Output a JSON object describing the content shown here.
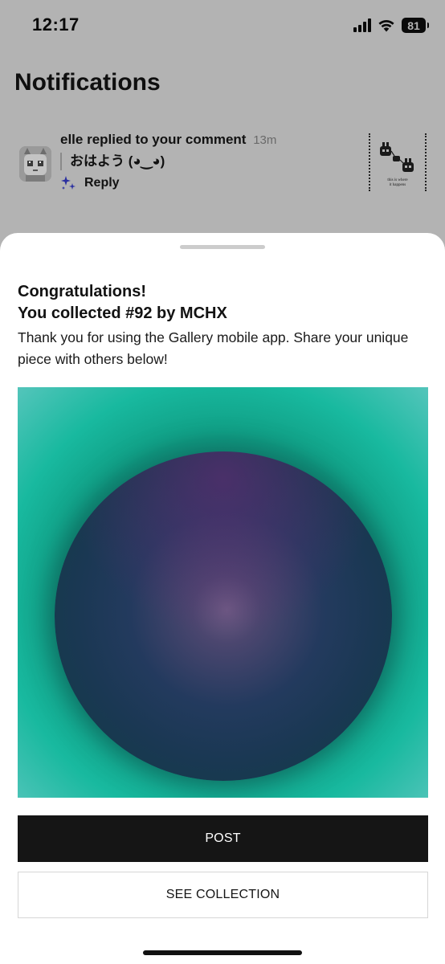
{
  "status_bar": {
    "time": "12:17",
    "battery": "81"
  },
  "background": {
    "title": "Notifications",
    "notification": {
      "text": "elle replied to your comment",
      "time": "13m",
      "quote": "おはよう (◕‿◕)",
      "reply_label": "Reply",
      "thumbnail_caption": "this is where it happens"
    }
  },
  "sheet": {
    "title_line1": "Congratulations!",
    "title_line2": "You collected #92 by MCHX",
    "body": "Thank you for using the Gallery mobile app. Share your unique piece with others below!",
    "post_button": "POST",
    "see_collection_button": "SEE COLLECTION"
  },
  "colors": {
    "overlay_background": "#b3b3b3",
    "artwork_teal": "#16a68a",
    "artwork_orb": "#1a3853",
    "artwork_highlight": "#6c5a83",
    "primary_button": "#151515"
  },
  "icons": {
    "signal": "cellular-signal-icon",
    "wifi": "wifi-icon",
    "battery": "battery-icon",
    "reply": "sparkle-icon"
  }
}
